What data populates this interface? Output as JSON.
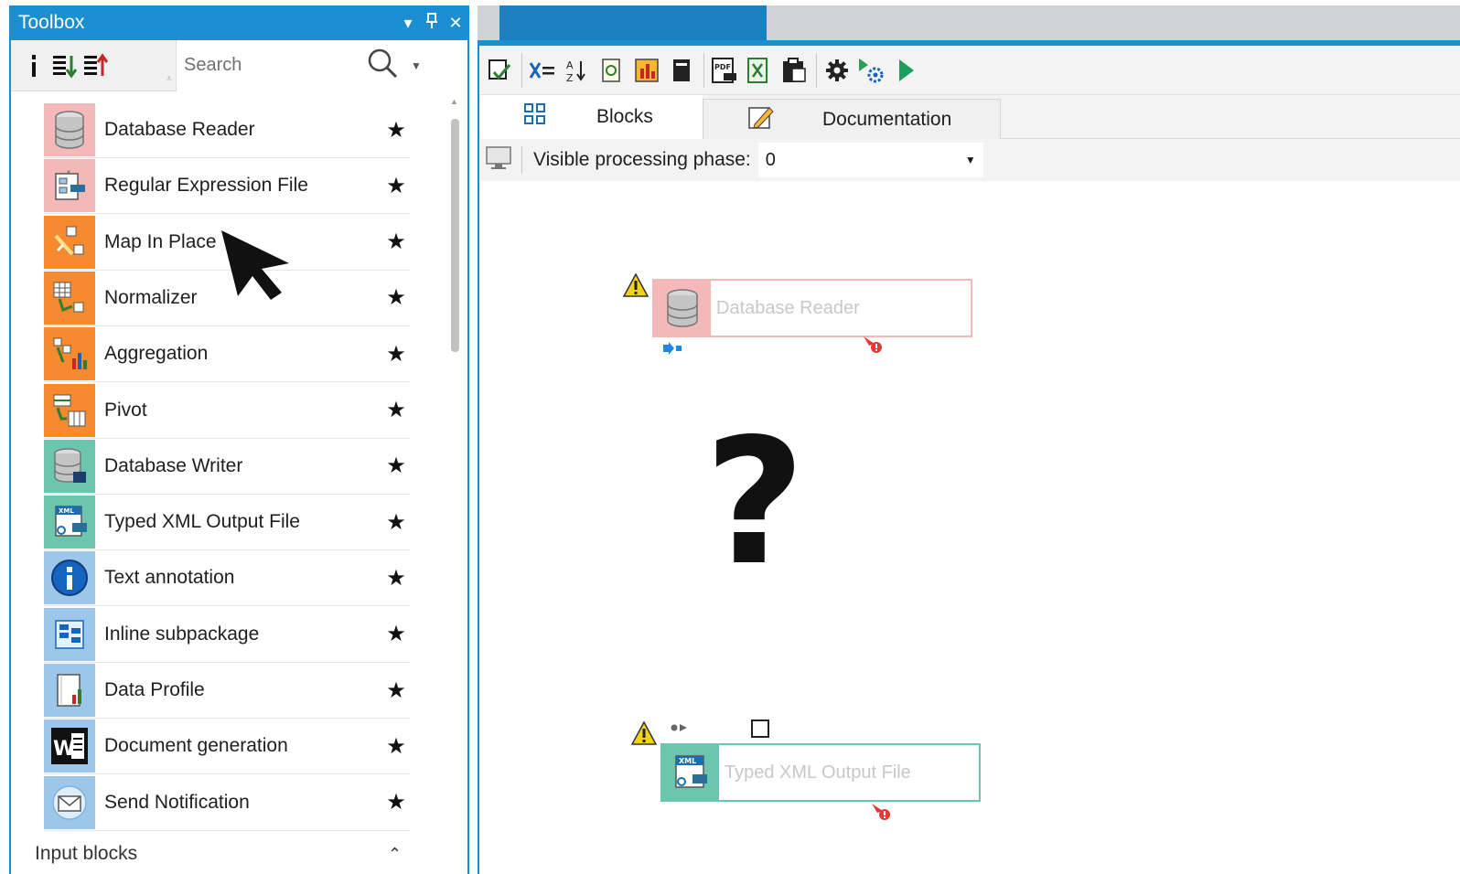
{
  "toolbox": {
    "title": "Toolbox",
    "search_placeholder": "Search",
    "items": [
      {
        "label": "Database Reader",
        "icon": "database-reader-icon",
        "bg": "#f4b8b8"
      },
      {
        "label": "Regular Expression File",
        "icon": "regex-file-icon",
        "bg": "#f4b8b8"
      },
      {
        "label": "Map In Place",
        "icon": "map-in-place-icon",
        "bg": "#f58a2e"
      },
      {
        "label": "Normalizer",
        "icon": "normalizer-icon",
        "bg": "#f58a2e"
      },
      {
        "label": "Aggregation",
        "icon": "aggregation-icon",
        "bg": "#f58a2e"
      },
      {
        "label": "Pivot",
        "icon": "pivot-icon",
        "bg": "#f58a2e"
      },
      {
        "label": "Database Writer",
        "icon": "database-writer-icon",
        "bg": "#6cc5ae"
      },
      {
        "label": "Typed XML Output File",
        "icon": "xml-output-icon",
        "bg": "#6cc5ae"
      },
      {
        "label": "Text annotation",
        "icon": "info-icon",
        "bg": "#9cc7ea"
      },
      {
        "label": "Inline subpackage",
        "icon": "subpackage-icon",
        "bg": "#9cc7ea"
      },
      {
        "label": "Data Profile",
        "icon": "data-profile-icon",
        "bg": "#9cc7ea"
      },
      {
        "label": "Document generation",
        "icon": "word-document-icon",
        "bg": "#9cc7ea"
      },
      {
        "label": "Send Notification",
        "icon": "envelope-icon",
        "bg": "#9cc7ea"
      }
    ],
    "group_label": "Input blocks"
  },
  "designer": {
    "tabs": [
      {
        "label": "Blocks",
        "icon": "blocks-grid-icon"
      },
      {
        "label": "Documentation",
        "icon": "pencil-note-icon"
      }
    ],
    "phase_label": "Visible processing phase:",
    "phase_value": "0",
    "blocks": [
      {
        "label": "Database Reader",
        "color": "#f4b8b8"
      },
      {
        "label": "Typed XML Output File",
        "color": "#6cc5ae"
      }
    ],
    "overlay_symbol": "?"
  },
  "colors": {
    "accent": "#1b8fd1",
    "warning": "#f2d21a",
    "error_port": "#e53935",
    "input_port": "#1e88e5"
  }
}
